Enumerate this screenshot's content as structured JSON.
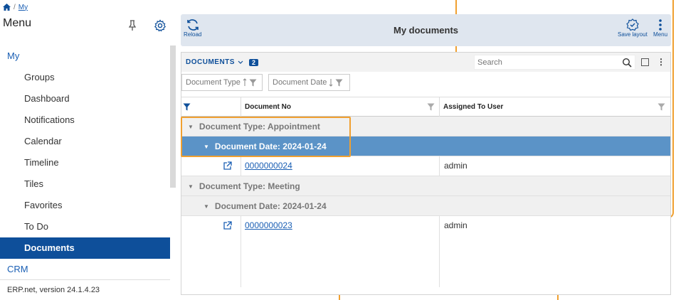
{
  "breadcrumb": {
    "current": "My"
  },
  "sidebar": {
    "title": "Menu",
    "items": [
      {
        "label": "My",
        "type": "group"
      },
      {
        "label": "Groups",
        "type": "item"
      },
      {
        "label": "Dashboard",
        "type": "item"
      },
      {
        "label": "Notifications",
        "type": "item"
      },
      {
        "label": "Calendar",
        "type": "item"
      },
      {
        "label": "Timeline",
        "type": "item"
      },
      {
        "label": "Tiles",
        "type": "item"
      },
      {
        "label": "Favorites",
        "type": "item"
      },
      {
        "label": "To Do",
        "type": "item"
      },
      {
        "label": "Documents",
        "type": "active"
      },
      {
        "label": "CRM",
        "type": "group"
      }
    ],
    "version": "ERP.net, version 24.1.4.23"
  },
  "toolbar": {
    "reload_label": "Reload",
    "title": "My documents",
    "save_layout_label": "Save layout",
    "menu_label": "Menu"
  },
  "panel": {
    "title": "DOCUMENTS",
    "count": "2",
    "search_placeholder": "Search",
    "chips": [
      "Document Type",
      "Document Date"
    ]
  },
  "grid": {
    "columns": [
      "Document No",
      "Assigned To User"
    ],
    "groups": [
      {
        "type_label": "Document Type: Appointment",
        "date_label": "Document Date: 2024-01-24",
        "rows": [
          {
            "doc_no": "0000000024",
            "user": "admin"
          }
        ]
      },
      {
        "type_label": "Document Type: Meeting",
        "date_label": "Document Date: 2024-01-24",
        "rows": [
          {
            "doc_no": "0000000023",
            "user": "admin"
          }
        ]
      }
    ]
  },
  "colors": {
    "accent": "#0e4f9a",
    "selected_group": "#5b93c7",
    "highlight": "#f0a030"
  }
}
